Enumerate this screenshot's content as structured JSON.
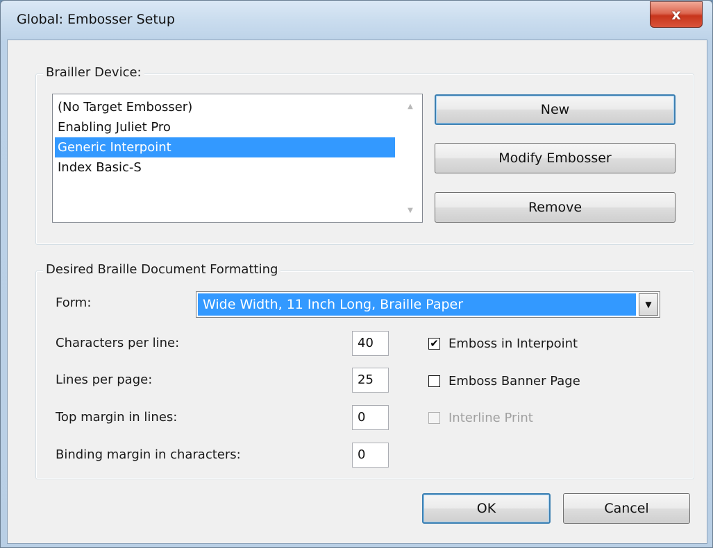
{
  "window": {
    "title": "Global: Embosser Setup",
    "close_glyph": "x"
  },
  "brailler_device": {
    "legend": "Brailler Device:",
    "devices": [
      {
        "label": "(No Target Embosser)",
        "selected": false
      },
      {
        "label": "Enabling Juliet Pro",
        "selected": false
      },
      {
        "label": "Generic Interpoint",
        "selected": true
      },
      {
        "label": "Index Basic-S",
        "selected": false
      }
    ],
    "buttons": {
      "new": "New",
      "modify": "Modify Embosser",
      "remove": "Remove"
    }
  },
  "formatting": {
    "legend": "Desired Braille Document Formatting",
    "form_label": "Form:",
    "form_value": "Wide Width, 11 Inch Long, Braille Paper",
    "fields": {
      "chars_per_line": {
        "label": "Characters per line:",
        "value": "40"
      },
      "lines_per_page": {
        "label": "Lines per page:",
        "value": "25"
      },
      "top_margin": {
        "label": "Top margin in lines:",
        "value": "0"
      },
      "binding_margin": {
        "label": "Binding margin in characters:",
        "value": "0"
      }
    },
    "options": {
      "emboss_interpoint": {
        "label": "Emboss in Interpoint",
        "checked": true,
        "enabled": true
      },
      "emboss_banner": {
        "label": "Emboss Banner Page",
        "checked": false,
        "enabled": true
      },
      "interline_print": {
        "label": "Interline Print",
        "checked": false,
        "enabled": false
      }
    }
  },
  "footer": {
    "ok": "OK",
    "cancel": "Cancel"
  },
  "icons": {
    "check": "✔",
    "scroll_up": "▲",
    "scroll_down": "▼",
    "dropdown": "▼"
  },
  "colors": {
    "selection": "#3399ff",
    "close_button": "#c7351c",
    "dialog_background": "#f0f0f0"
  }
}
